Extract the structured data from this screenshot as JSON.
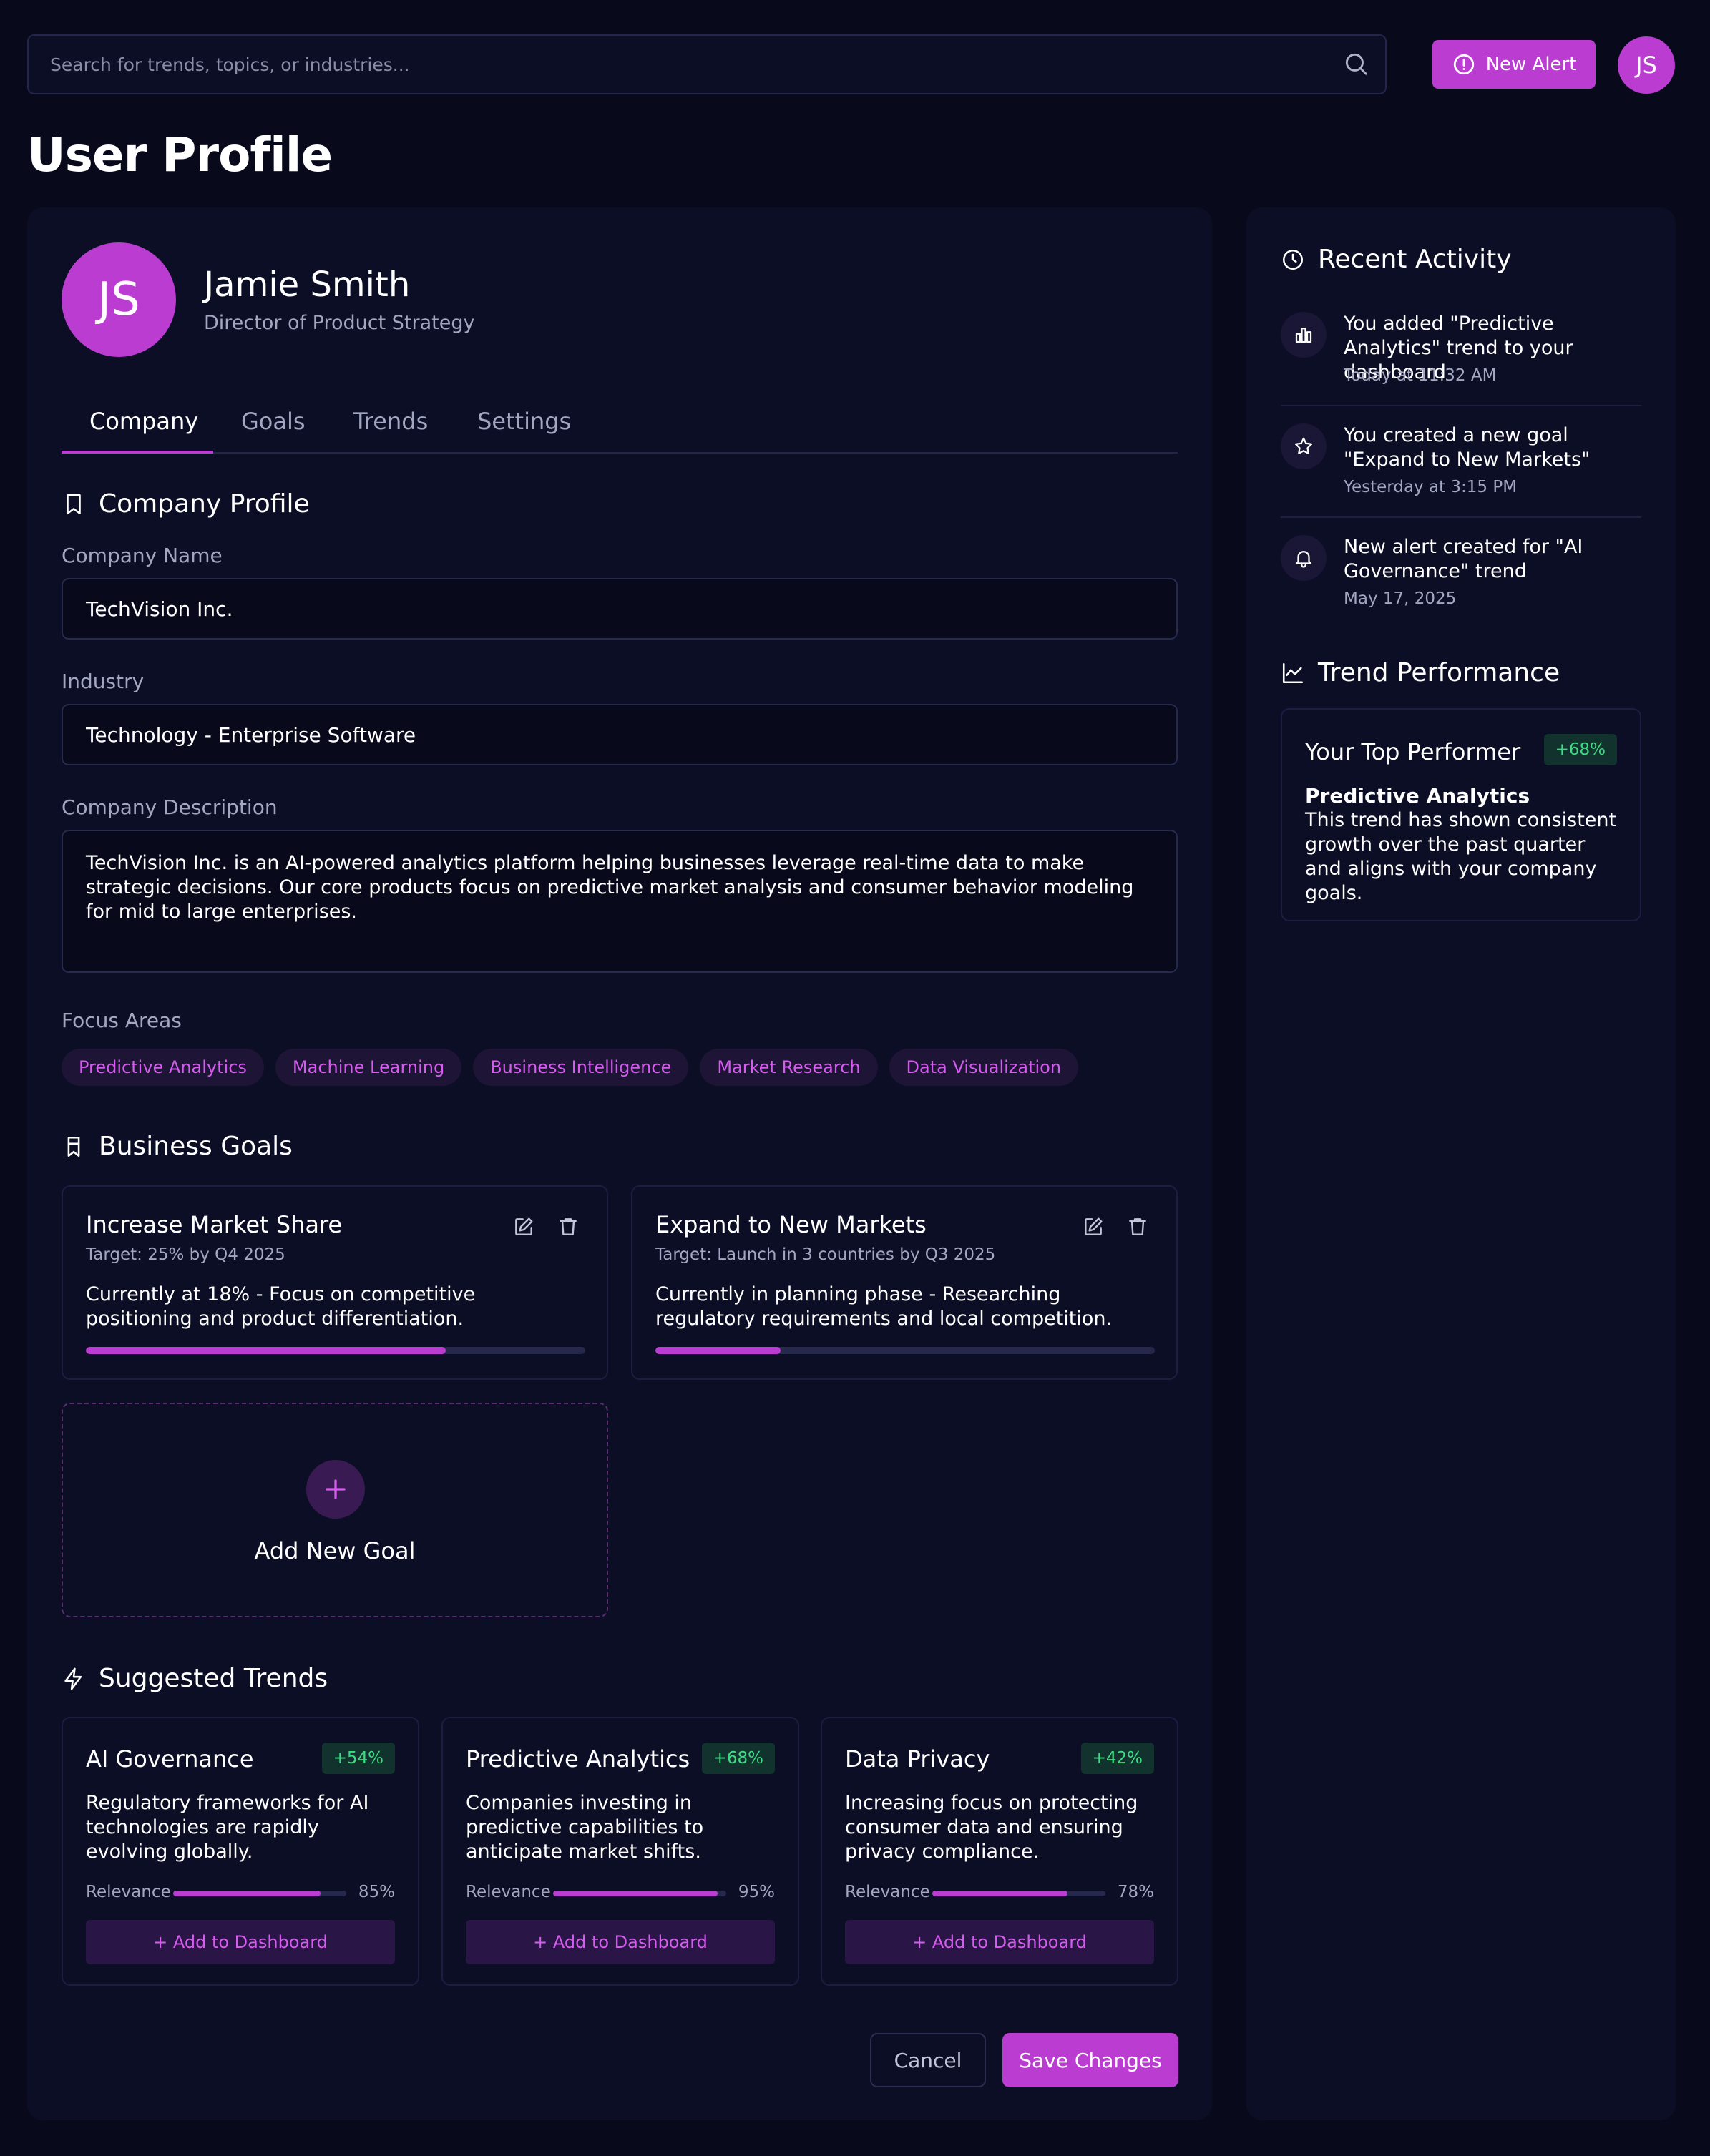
{
  "header": {
    "search_placeholder": "Search for trends, topics, or industries...",
    "new_alert_label": "New Alert",
    "avatar_initials": "JS"
  },
  "page_title": "User Profile",
  "profile": {
    "initials": "JS",
    "name": "Jamie Smith",
    "role": "Director of Product Strategy"
  },
  "tabs": [
    {
      "label": "Company",
      "active": true
    },
    {
      "label": "Goals",
      "active": false
    },
    {
      "label": "Trends",
      "active": false
    },
    {
      "label": "Settings",
      "active": false
    }
  ],
  "company_profile": {
    "title": "Company Profile",
    "name_label": "Company Name",
    "name_value": "TechVision Inc.",
    "industry_label": "Industry",
    "industry_value": "Technology - Enterprise Software",
    "description_label": "Company Description",
    "description_value": "TechVision Inc. is an AI-powered analytics platform helping businesses leverage real-time data to make strategic decisions. Our core products focus on predictive market analysis and consumer behavior modeling for mid to large enterprises.",
    "focus_label": "Focus Areas",
    "focus_areas": [
      "Predictive Analytics",
      "Machine Learning",
      "Business Intelligence",
      "Market Research",
      "Data Visualization"
    ]
  },
  "business_goals": {
    "title": "Business Goals",
    "goals": [
      {
        "title": "Increase Market Share",
        "target": "Target: 25% by Q4 2025",
        "description": "Currently at 18% - Focus on competitive positioning and product differentiation.",
        "progress_percent": 72
      },
      {
        "title": "Expand to New Markets",
        "target": "Target: Launch in 3 countries by Q3 2025",
        "description": "Currently in planning phase - Researching regulatory requirements and local competition.",
        "progress_percent": 25
      }
    ],
    "add_label": "Add New Goal"
  },
  "suggested_trends": {
    "title": "Suggested Trends",
    "relevance_label": "Relevance",
    "add_button_label": "+ Add to Dashboard",
    "trends": [
      {
        "title": "AI Governance",
        "change": "+54%",
        "description": "Regulatory frameworks for AI technologies are rapidly evolving globally.",
        "relevance_percent": 85,
        "relevance": "85%"
      },
      {
        "title": "Predictive Analytics",
        "change": "+68%",
        "description": "Companies investing in predictive capabilities to anticipate market shifts.",
        "relevance_percent": 95,
        "relevance": "95%"
      },
      {
        "title": "Data Privacy",
        "change": "+42%",
        "description": "Increasing focus on protecting consumer data and ensuring privacy compliance.",
        "relevance_percent": 78,
        "relevance": "78%"
      }
    ]
  },
  "actions": {
    "cancel_label": "Cancel",
    "save_label": "Save Changes"
  },
  "recent_activity": {
    "title": "Recent Activity",
    "items": [
      {
        "icon": "bar-chart-icon",
        "text": "You added \"Predictive Analytics\" trend to your dashboard",
        "time": "Today at 11:32 AM"
      },
      {
        "icon": "star-icon",
        "text": "You created a new goal \"Expand to New Markets\"",
        "time": "Yesterday at 3:15 PM"
      },
      {
        "icon": "bell-icon",
        "text": "New alert created for \"AI Governance\" trend",
        "time": "May 17, 2025"
      }
    ]
  },
  "trend_performance": {
    "title": "Trend Performance",
    "card_title": "Your Top Performer",
    "change": "+68%",
    "name": "Predictive Analytics",
    "description": "This trend has shown consistent growth over the past quarter and aligns with your company goals."
  },
  "colors": {
    "accent": "#bb3cd0",
    "background": "#080a1c",
    "panel": "#0c0e26",
    "positive": "#3ddc84"
  }
}
